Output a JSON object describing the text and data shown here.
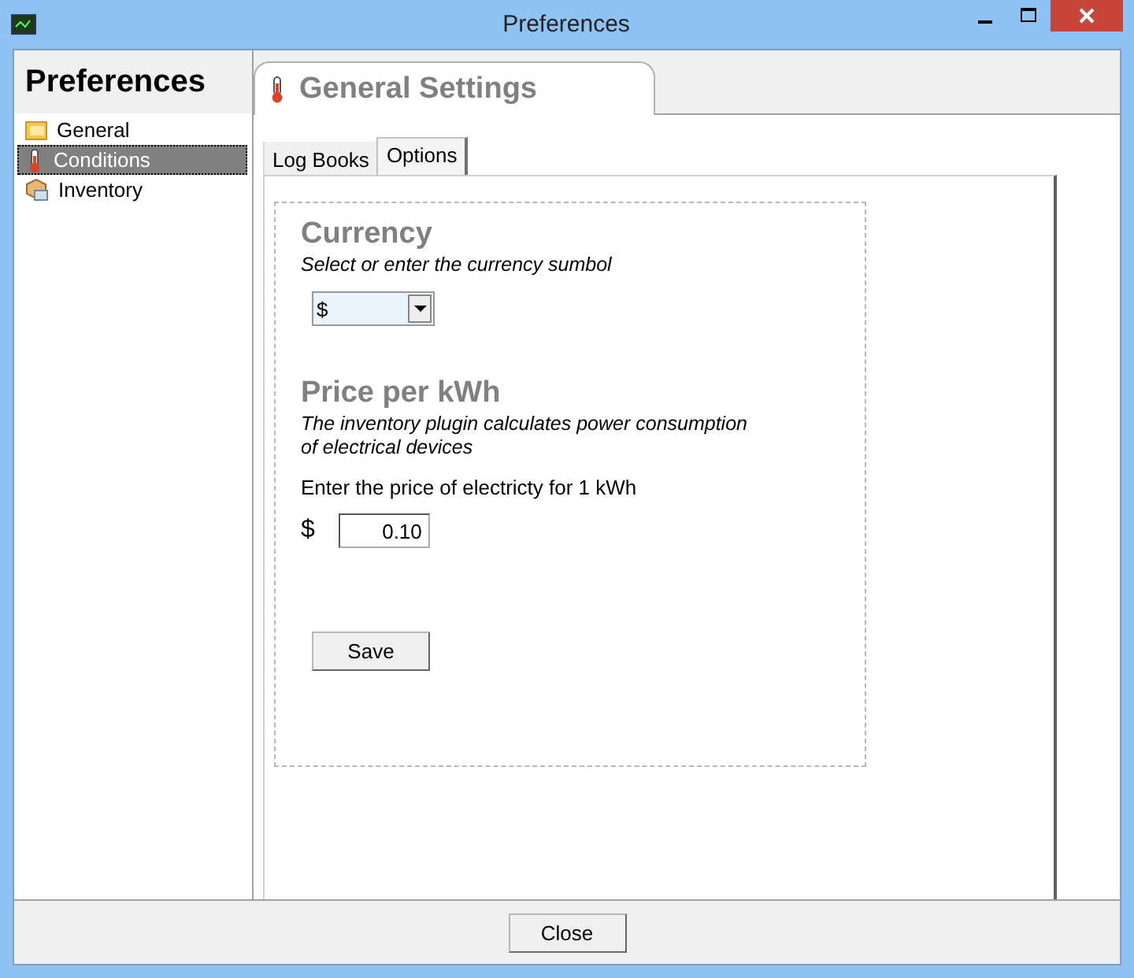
{
  "window": {
    "title": "Preferences"
  },
  "sidebar": {
    "title": "Preferences",
    "items": [
      {
        "label": "General",
        "kind": "folder",
        "selected": false
      },
      {
        "label": "Conditions",
        "kind": "thermometer",
        "selected": true
      },
      {
        "label": "Inventory",
        "kind": "package",
        "selected": false
      }
    ]
  },
  "page": {
    "title": "General Settings",
    "tabs": [
      {
        "label": "Log Books",
        "selected": false
      },
      {
        "label": "Options",
        "selected": true
      }
    ]
  },
  "currency": {
    "heading": "Currency",
    "hint": "Select or enter the currency sumbol",
    "value": "$"
  },
  "price": {
    "heading": "Price per kWh",
    "hint_lines": [
      "The inventory plugin calculates power consumption",
      "of electrical devices"
    ],
    "prompt": "Enter the price of electricty  for 1 kWh",
    "symbol": "$",
    "value": "0.10"
  },
  "save_button": "Save",
  "close_button": "Close"
}
